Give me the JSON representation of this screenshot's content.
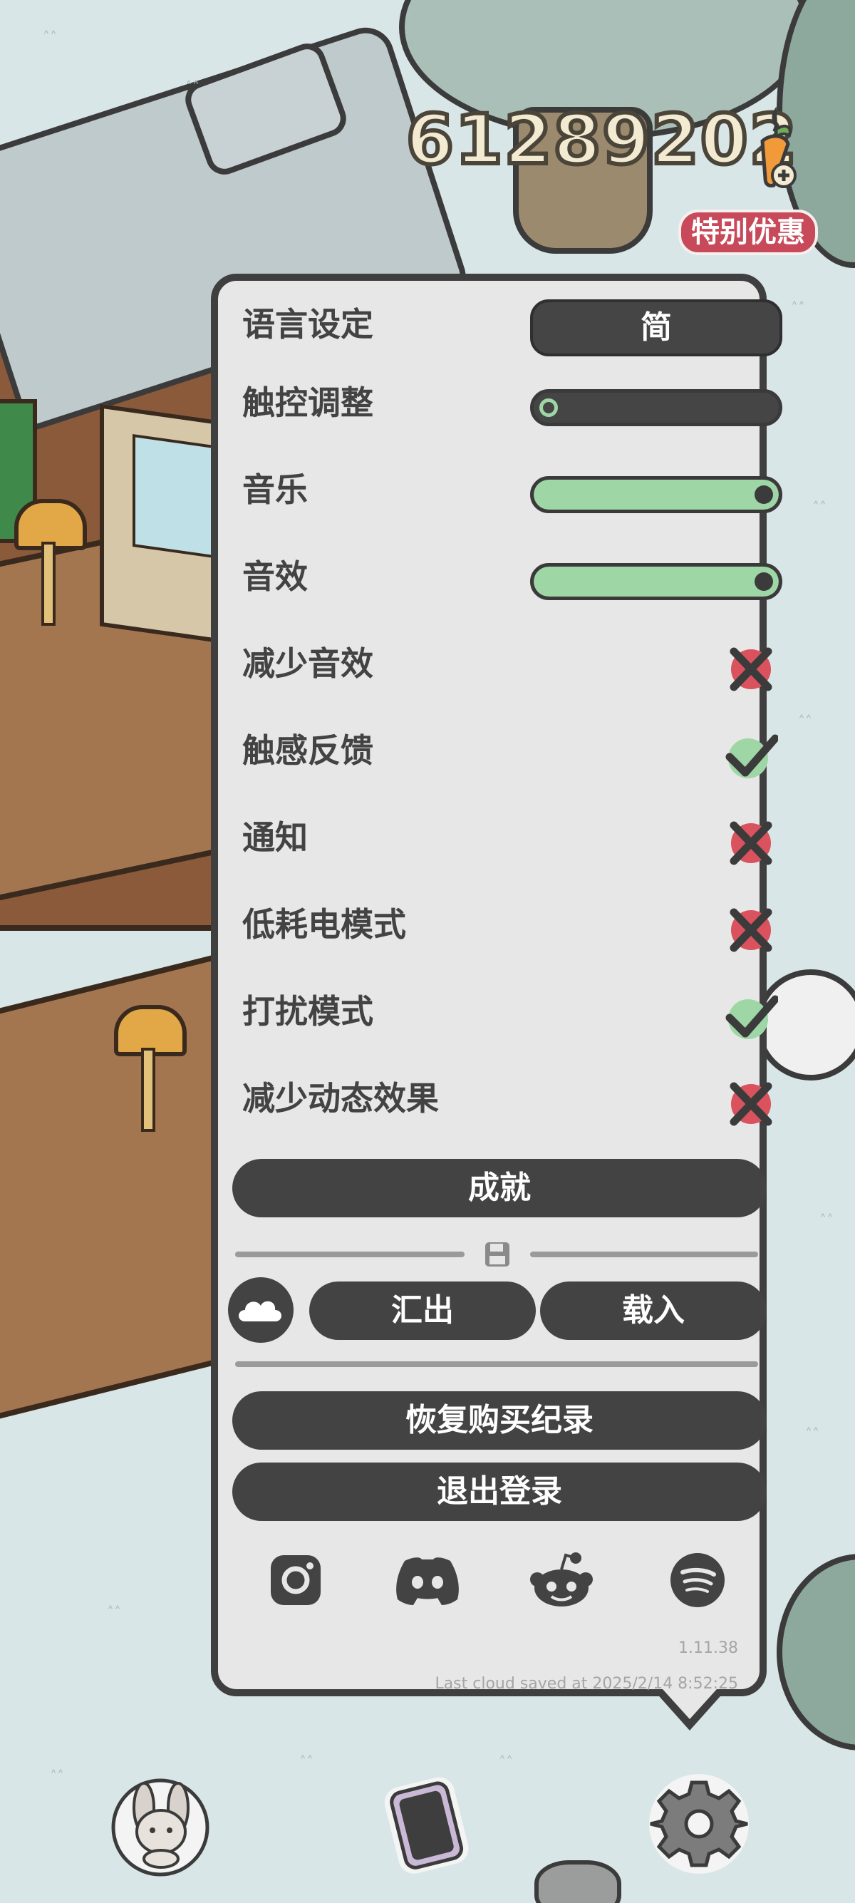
{
  "hud": {
    "carrot_count": "61289202",
    "special_offer_label": "特别优惠",
    "add_currency_icon": "carrot-plus-icon"
  },
  "settings": {
    "language": {
      "label": "语言设定",
      "value": "简"
    },
    "touch_adjust": {
      "label": "触控调整",
      "level": 0.0
    },
    "music": {
      "label": "音乐",
      "level": 1.0
    },
    "sound_effects": {
      "label": "音效",
      "level": 1.0
    },
    "reduce_sfx": {
      "label": "减少音效",
      "enabled": false
    },
    "haptics": {
      "label": "触感反馈",
      "enabled": true
    },
    "notifications": {
      "label": "通知",
      "enabled": false
    },
    "low_power": {
      "label": "低耗电模式",
      "enabled": false
    },
    "do_not_disturb": {
      "label": "打扰模式",
      "enabled": true
    },
    "reduce_motion": {
      "label": "减少动态效果",
      "enabled": false
    }
  },
  "buttons": {
    "achievements": "成就",
    "export": "汇出",
    "import": "载入",
    "restore_purchases": "恢复购买纪录",
    "logout": "退出登录"
  },
  "social": [
    "instagram-icon",
    "discord-icon",
    "reddit-icon",
    "spotify-icon"
  ],
  "footer": {
    "version": "1.11.38",
    "last_saved": "Last cloud saved at 2025/2/14 8:52:25"
  },
  "colors": {
    "panel_bg": "#e7e7e7",
    "dark": "#434343",
    "on_green": "#9ed6a6",
    "off_red": "#d9525e",
    "offer_red": "#c84a5a"
  },
  "bottom_nav": [
    "bunny-icon",
    "phone-icon",
    "settings-gear-icon"
  ]
}
